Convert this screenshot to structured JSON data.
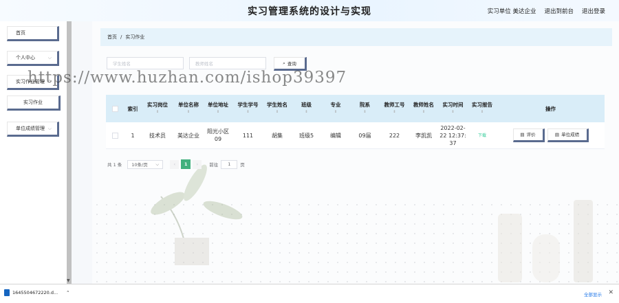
{
  "header": {
    "title": "实习管理系统的设计与实现",
    "links": [
      "实习单位 美达企业",
      "退出到前台",
      "退出登录"
    ]
  },
  "sidebar": {
    "items": [
      {
        "label": "首页"
      },
      {
        "label": "个人中心"
      },
      {
        "label": "实习作业管理"
      },
      {
        "label": "实习作业"
      },
      {
        "label": "单位成绩管理"
      }
    ]
  },
  "breadcrumb": {
    "home": "首页",
    "sep": "/",
    "current": "实习作业"
  },
  "search": {
    "student_name_placeholder": "学生姓名",
    "teacher_name_placeholder": "教师姓名",
    "button_label": "查询"
  },
  "table": {
    "columns": [
      "索引",
      "实习岗位",
      "单位名称",
      "单位地址",
      "学生学号",
      "学生姓名",
      "班级",
      "专业",
      "院系",
      "教师工号",
      "教师姓名",
      "实习时间",
      "实习报告",
      "操作"
    ],
    "rows": [
      {
        "index": "1",
        "position": "技术员",
        "company": "美达企业",
        "address": "阳光小区09",
        "student_no": "111",
        "student_name": "胡集",
        "class": "班级5",
        "major": "编辑",
        "department": "09届",
        "teacher_no": "222",
        "teacher_name": "李凯凯",
        "time": "2022-02-22 12:37:37",
        "report": "下载",
        "actions": [
          "评价",
          "单位成绩"
        ]
      }
    ]
  },
  "pagination": {
    "total": "共 1 条",
    "page_size": "10条/页",
    "current_page": "1",
    "goto_label": "前往",
    "goto_value": "1",
    "page_unit": "页"
  },
  "watermark": "https://www.huzhan.com/ishop39397",
  "downloads": {
    "file_name": "1645504672220.d...",
    "show_all": "全部显示"
  }
}
